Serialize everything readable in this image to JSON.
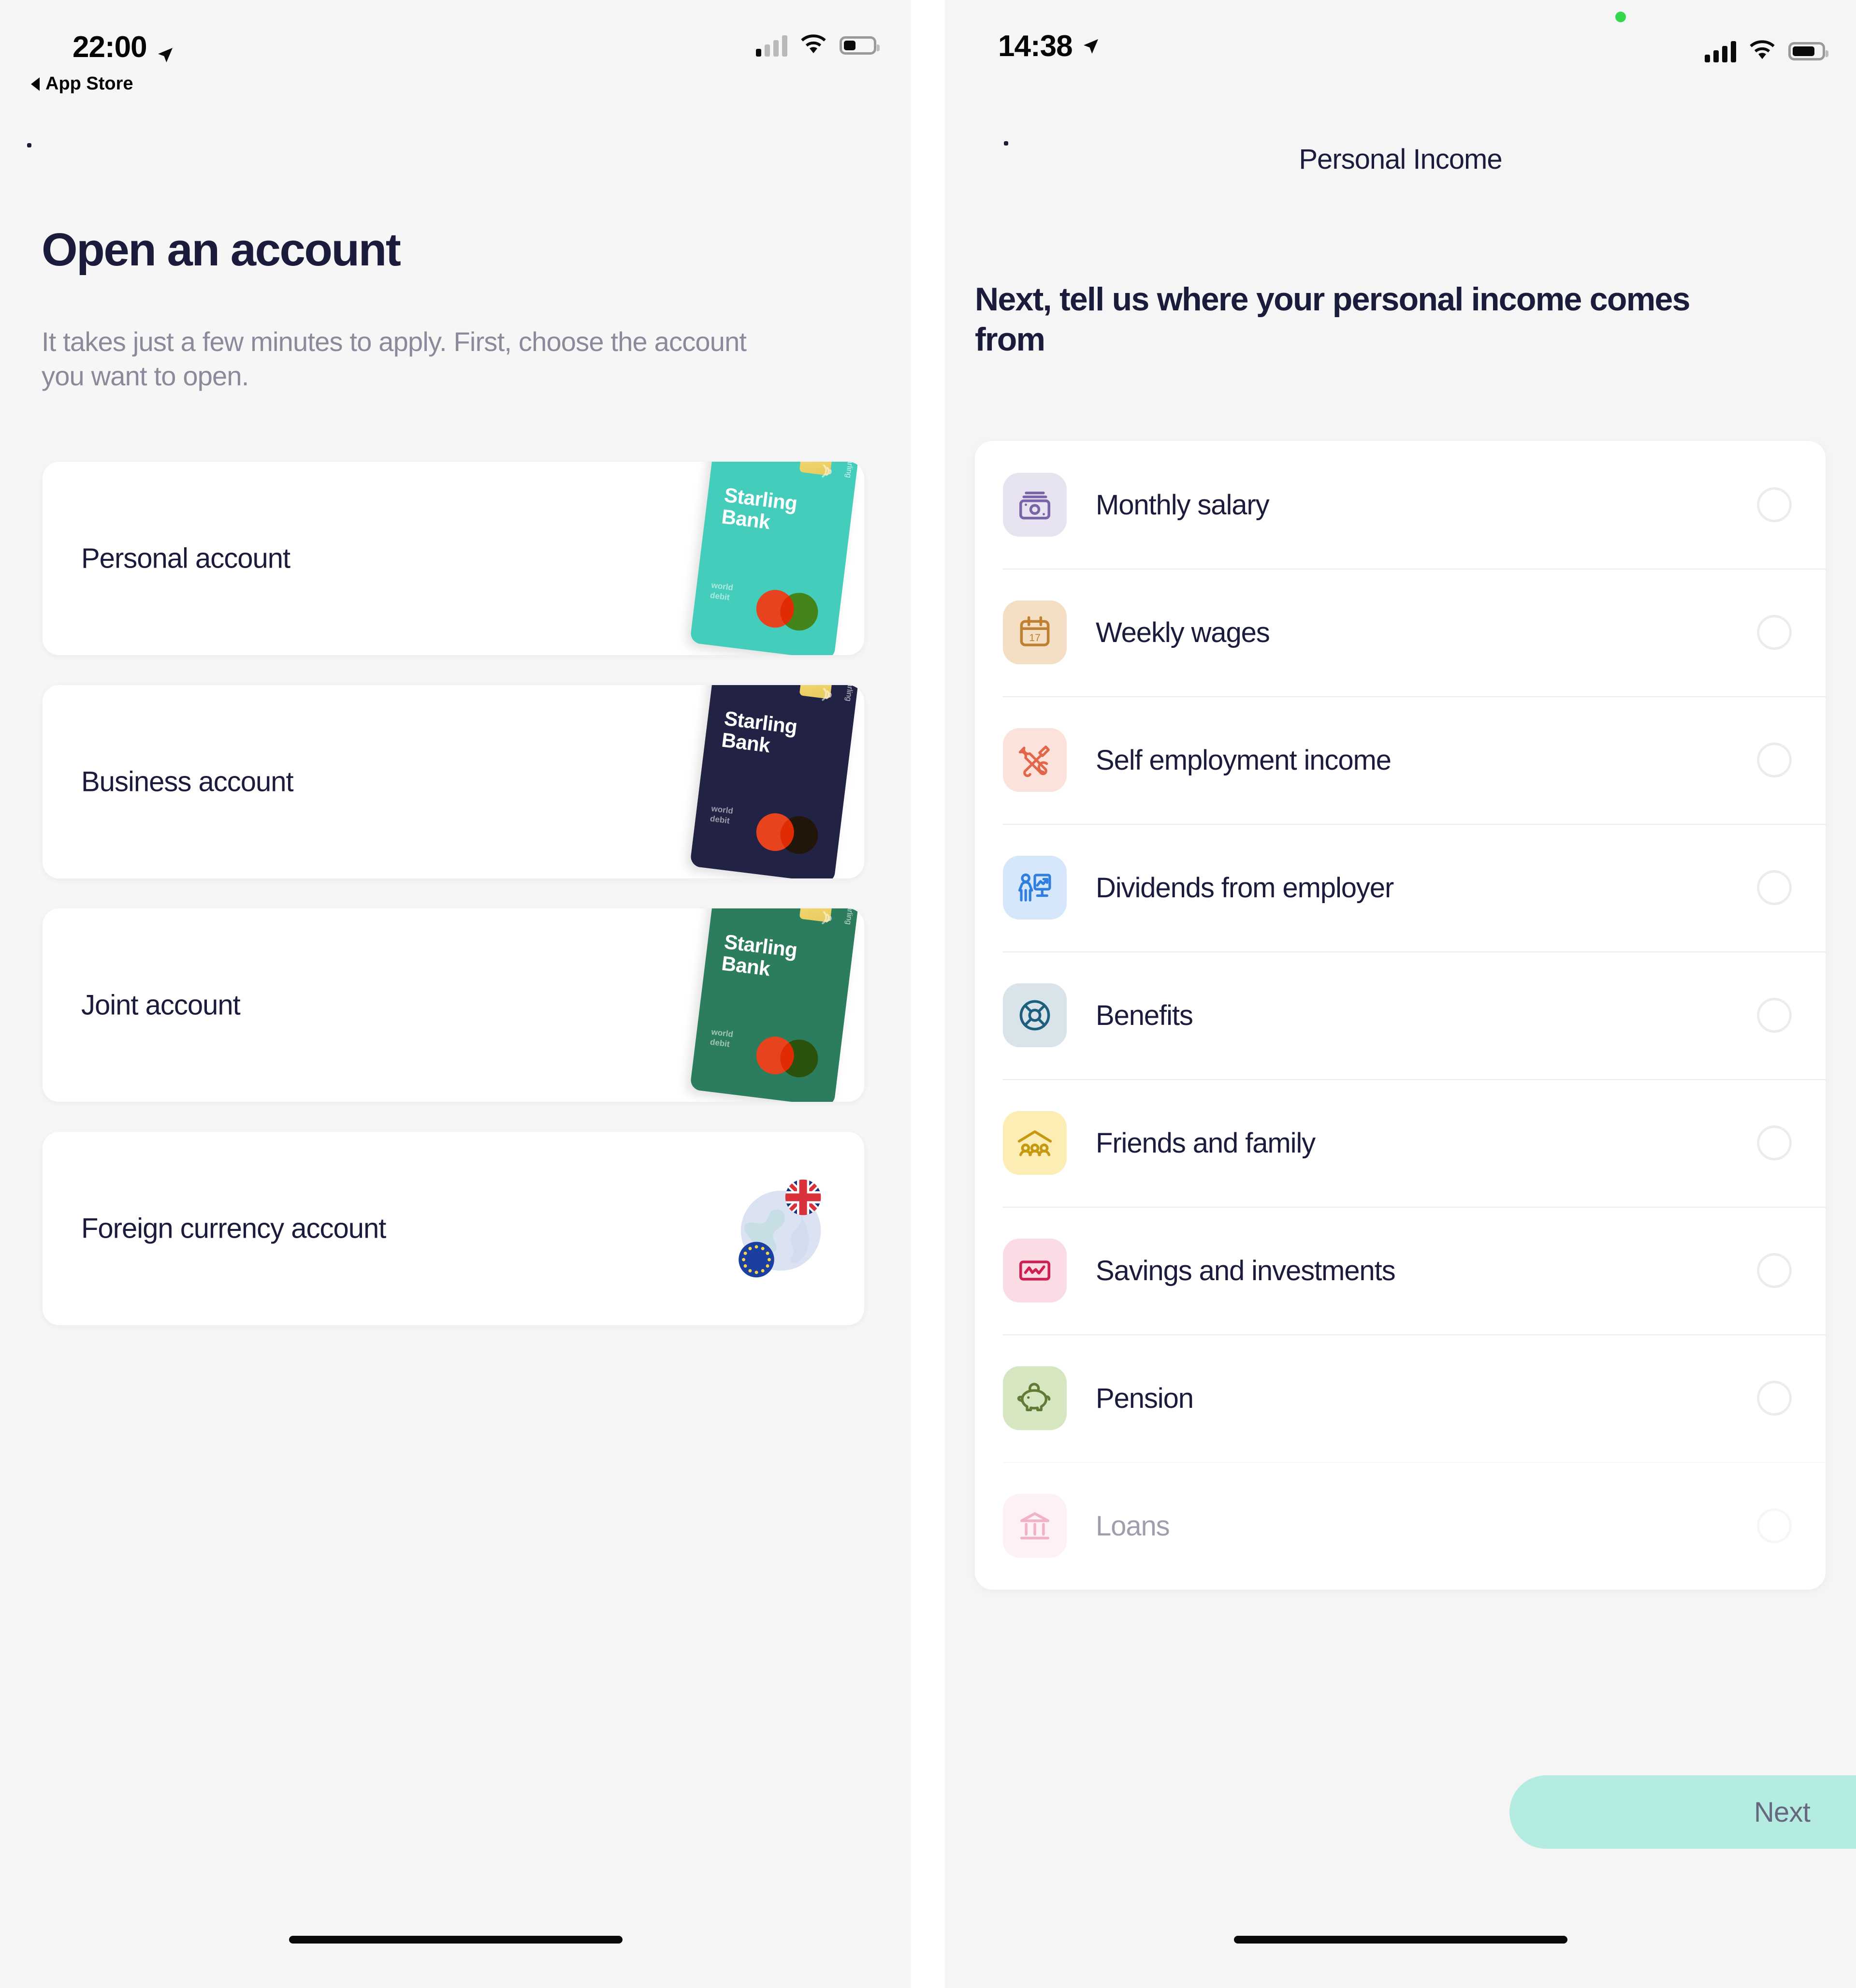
{
  "left": {
    "status": {
      "time": "22:00",
      "back_app_label": "App Store",
      "location_icon": "location-arrow-icon",
      "signal_icon": "cellular-signal-icon",
      "wifi_icon": "wifi-icon",
      "battery_icon": "battery-icon"
    },
    "back_icon": "back-chevron-icon",
    "title": "Open an account",
    "subtitle": "It takes just a few minutes to apply. First, choose the account you want to open.",
    "accounts": [
      {
        "label": "Personal account",
        "art": "starling-card-teal",
        "brand_line1": "Starling",
        "brand_line2": "Bank",
        "card_color": "#45cdbb",
        "small_text": "world\ndebit"
      },
      {
        "label": "Business account",
        "art": "starling-card-navy",
        "brand_line1": "Starling",
        "brand_line2": "Bank",
        "card_color": "#212244",
        "small_text": "world\ndebit"
      },
      {
        "label": "Joint account",
        "art": "starling-card-green",
        "brand_line1": "Starling",
        "brand_line2": "Bank",
        "card_color": "#2b7d5d",
        "small_text": "world\ndebit"
      },
      {
        "label": "Foreign currency account",
        "art": "globe-flags-icon",
        "brand_line1": "",
        "brand_line2": "",
        "card_color": "",
        "small_text": ""
      }
    ]
  },
  "right": {
    "status": {
      "time": "14:38",
      "location_icon": "location-arrow-icon",
      "recording_dot": "green-recording-dot",
      "signal_icon": "cellular-signal-icon",
      "wifi_icon": "wifi-icon",
      "battery_icon": "battery-icon"
    },
    "back_icon": "back-chevron-icon",
    "nav_title": "Personal Income",
    "heading": "Next, tell us where your personal income comes from",
    "income_sources": [
      {
        "label": "Monthly salary",
        "icon": "banknote-icon",
        "icon_bg": "#e7e3f1",
        "icon_color": "#7b63a8",
        "selected": false
      },
      {
        "label": "Weekly wages",
        "icon": "calendar-17-icon",
        "icon_bg": "#f4dfc4",
        "icon_color": "#bf8032",
        "selected": false
      },
      {
        "label": "Self employment income",
        "icon": "tools-icon",
        "icon_bg": "#fbe3dc",
        "icon_color": "#e2674a",
        "selected": false
      },
      {
        "label": "Dividends from employer",
        "icon": "person-chart-icon",
        "icon_bg": "#d6e6fb",
        "icon_color": "#2f7fe0",
        "selected": false
      },
      {
        "label": "Benefits",
        "icon": "lifebuoy-icon",
        "icon_bg": "#d9e4ea",
        "icon_color": "#1e5f7e",
        "selected": false
      },
      {
        "label": "Friends and family",
        "icon": "house-people-icon",
        "icon_bg": "#fbedb4",
        "icon_color": "#c59a10",
        "selected": false
      },
      {
        "label": "Savings and investments",
        "icon": "chart-box-icon",
        "icon_bg": "#fbdbe4",
        "icon_color": "#cf1f50",
        "selected": false
      },
      {
        "label": "Pension",
        "icon": "piggy-bank-icon",
        "icon_bg": "#d6e6c1",
        "icon_color": "#5f7b35",
        "selected": false
      },
      {
        "label": "Loans",
        "icon": "bank-building-icon",
        "icon_bg": "#fbe0ea",
        "icon_color": "#e0487f",
        "selected": false
      }
    ],
    "next_label": "Next",
    "calendar_day": "17"
  },
  "colors": {
    "background": "#f6f6f6",
    "card": "#ffffff",
    "text_primary": "#1b1b3c",
    "text_muted": "#8a8a9b",
    "accent_mint": "#b5ece1",
    "divider": "#ececee"
  }
}
